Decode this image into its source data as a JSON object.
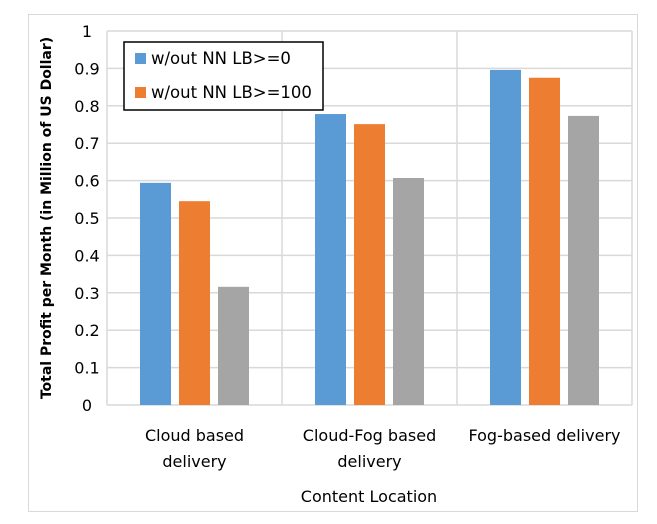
{
  "chart_data": {
    "type": "bar",
    "title": "",
    "xlabel": "Content Location",
    "ylabel": "Total Profit per Month (in Million of US Dollar)",
    "ylim": [
      0,
      1
    ],
    "yticks": [
      "0",
      "0.1",
      "0.2",
      "0.3",
      "0.4",
      "0.5",
      "0.6",
      "0.7",
      "0.8",
      "0.9",
      "1"
    ],
    "grid": true,
    "legend_position": "top-left",
    "categories": [
      [
        "Cloud based",
        "delivery"
      ],
      [
        "Cloud-Fog based",
        "delivery"
      ],
      [
        "Fog-based delivery"
      ]
    ],
    "series": [
      {
        "name": "w/out NN LB>=0",
        "color": "#5b9bd5",
        "values": [
          0.594,
          0.778,
          0.896
        ]
      },
      {
        "name": "w/out NN LB>=100",
        "color": "#ed7d31",
        "values": [
          0.545,
          0.751,
          0.875
        ]
      },
      {
        "name": "",
        "color": "#a5a5a5",
        "values": [
          0.316,
          0.607,
          0.773
        ]
      }
    ]
  }
}
